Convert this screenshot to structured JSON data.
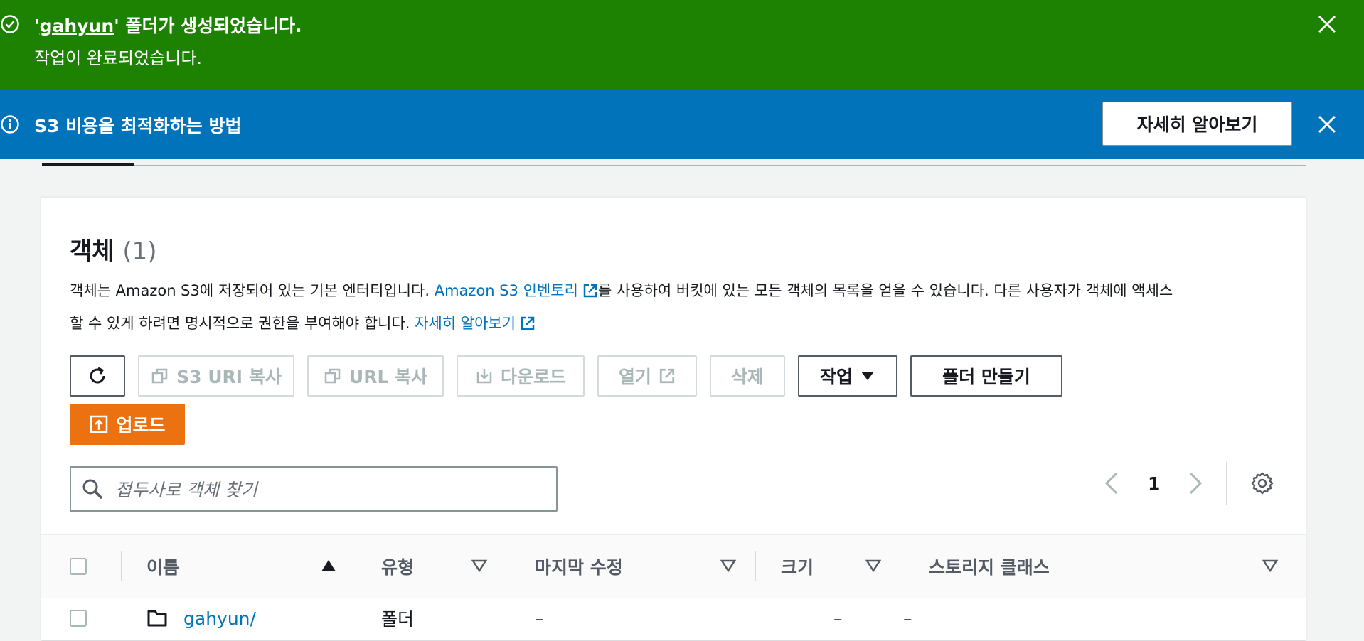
{
  "flash_success": {
    "title_quote_open": "'",
    "folder_name": "gahyun",
    "title_rest": "' 폴더가 생성되었습니다.",
    "subtitle": "작업이 완료되었습니다."
  },
  "flash_info": {
    "title": "S3 비용을 최적화하는 방법",
    "learn_more_label": "자세히 알아보기"
  },
  "objects": {
    "title": "객체",
    "count": "(1)",
    "desc_part1": "객체는 Amazon S3에 저장되어 있는 기본 엔터티입니다. ",
    "inventory_link": "Amazon S3 인벤토리",
    "desc_part2": "를 사용하여 버킷에 있는 모든 객체의 목록을 얻을 수 있습니다. 다른 사용자가 객체에 액세스",
    "desc_part3": "할 수 있게 하려면 명시적으로 권한을 부여해야 합니다. ",
    "learn_more_link": "자세히 알아보기"
  },
  "toolbar": {
    "copy_s3_uri": "S3 URI 복사",
    "copy_url": "URL 복사",
    "download": "다운로드",
    "open": "열기",
    "delete": "삭제",
    "actions": "작업",
    "create_folder": "폴더 만들기",
    "upload": "업로드"
  },
  "search": {
    "placeholder": "접두사로 객체 찾기"
  },
  "pagination": {
    "current_page": "1"
  },
  "table": {
    "columns": [
      "이름",
      "유형",
      "마지막 수정",
      "크기",
      "스토리지 클래스"
    ],
    "rows": [
      {
        "name": "gahyun/",
        "type": "폴더",
        "last_modified": "–",
        "size": "–",
        "storage_class": "–"
      }
    ]
  },
  "colors": {
    "success": "#1d8102",
    "info": "#0073bb",
    "primary": "#ec7211",
    "link": "#0073bb"
  }
}
